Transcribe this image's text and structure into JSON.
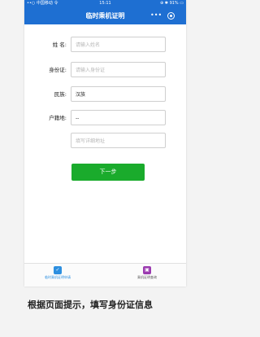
{
  "status_bar": {
    "carrier": "••○ 中国移动 令",
    "time": "15:11",
    "right": "⊕ ✱ 91% ▭"
  },
  "header": {
    "title": "临时乘机证明"
  },
  "form": {
    "name": {
      "label": "姓 名:",
      "placeholder": "请输入姓名"
    },
    "id_card": {
      "label": "身份证:",
      "placeholder": "请输入身份证"
    },
    "ethnicity": {
      "label": "民族:",
      "value": "汉族"
    },
    "hukou": {
      "label": "户籍地:",
      "value": "--"
    },
    "address": {
      "placeholder": "填写详细地址"
    }
  },
  "next_button": {
    "label": "下一步"
  },
  "tabs": [
    {
      "label": "临时乘机证明申请",
      "color": "#2d8fe0"
    },
    {
      "label": "乘机证明查询",
      "color": "#9b3bb0"
    }
  ],
  "caption": "根据页面提示，填写身份证信息",
  "colors": {
    "brand_blue": "#1e6fd2",
    "primary_button": "#1aab2c"
  }
}
